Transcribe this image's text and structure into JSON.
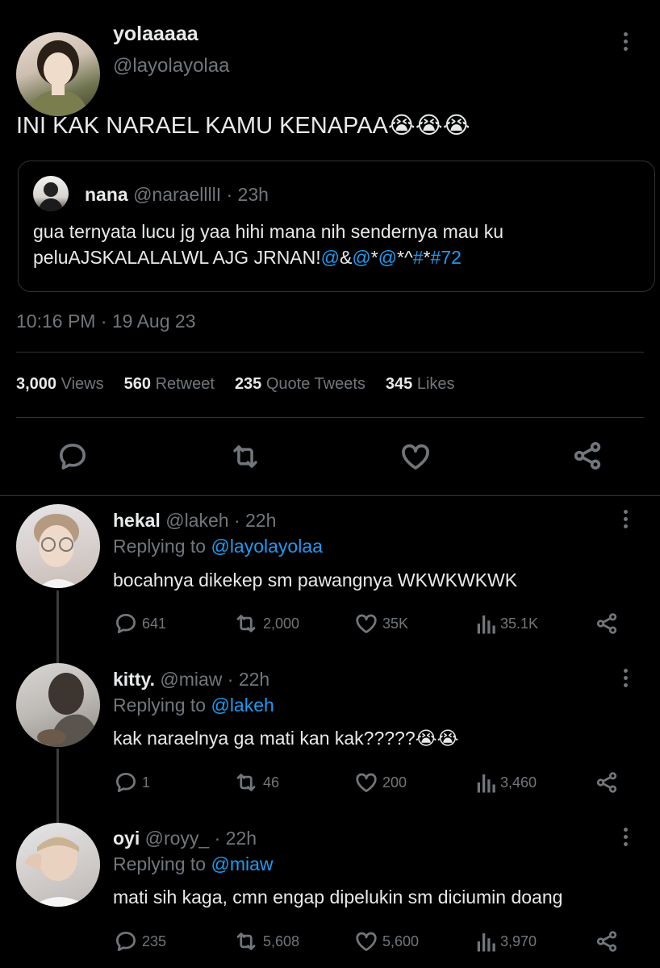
{
  "tweet": {
    "display_name": "yolaaaaa",
    "handle": "@layolayolaa",
    "text": "INI KAK NARAEL KAMU KENAPAA",
    "emoji": "😭😭😭",
    "quote": {
      "display_name": "nana",
      "handle": "@naraellllI",
      "time": "· 23h",
      "line1": "gua ternyata lucu jg yaa hihi mana nih sendernya mau ku",
      "line2_prefix": "peluAJSKALALALWL AJG JRNAN!",
      "line2_parts": [
        "@",
        "&",
        "@",
        "*",
        "@",
        "*^",
        "#",
        "*",
        "#72"
      ]
    },
    "timestamp": "10:16 PM · 19 Aug 23",
    "stats": {
      "views_count": "3,000",
      "views_label": "Views",
      "retweets_count": "560",
      "retweets_label": "Retweet",
      "quotes_count": "235",
      "quotes_label": "Quote Tweets",
      "likes_count": "345",
      "likes_label": "Likes"
    }
  },
  "replies": [
    {
      "display_name": "hekal",
      "handle": "@lakeh",
      "time": "· 22h",
      "replying_prefix": "Replying to",
      "replying_to": "@layolayolaa",
      "text": "bocahnya dikekep sm pawangnya WKWKWKWK",
      "emoji": "",
      "replies": "641",
      "retweets": "2,000",
      "likes": "35K",
      "views": "35.1K"
    },
    {
      "display_name": "kitty.",
      "handle": "@miaw",
      "time": "· 22h",
      "replying_prefix": "Replying to",
      "replying_to": "@lakeh",
      "text": "kak naraelnya ga mati kan kak?????",
      "emoji": "😭😭",
      "replies": "1",
      "retweets": "46",
      "likes": "200",
      "views": "3,460"
    },
    {
      "display_name": "oyi",
      "handle": "@royy_",
      "time": "· 22h",
      "replying_prefix": "Replying to",
      "replying_to": "@miaw",
      "text": "mati sih kaga, cmn engap dipelukin sm diciumin doang",
      "emoji": "",
      "replies": "235",
      "retweets": "5,608",
      "likes": "5,600",
      "views": "3,970"
    }
  ],
  "colors": {
    "background": "#000000",
    "link": "#1d9bf0",
    "muted": "#71767b",
    "text": "#e7e9ea"
  }
}
